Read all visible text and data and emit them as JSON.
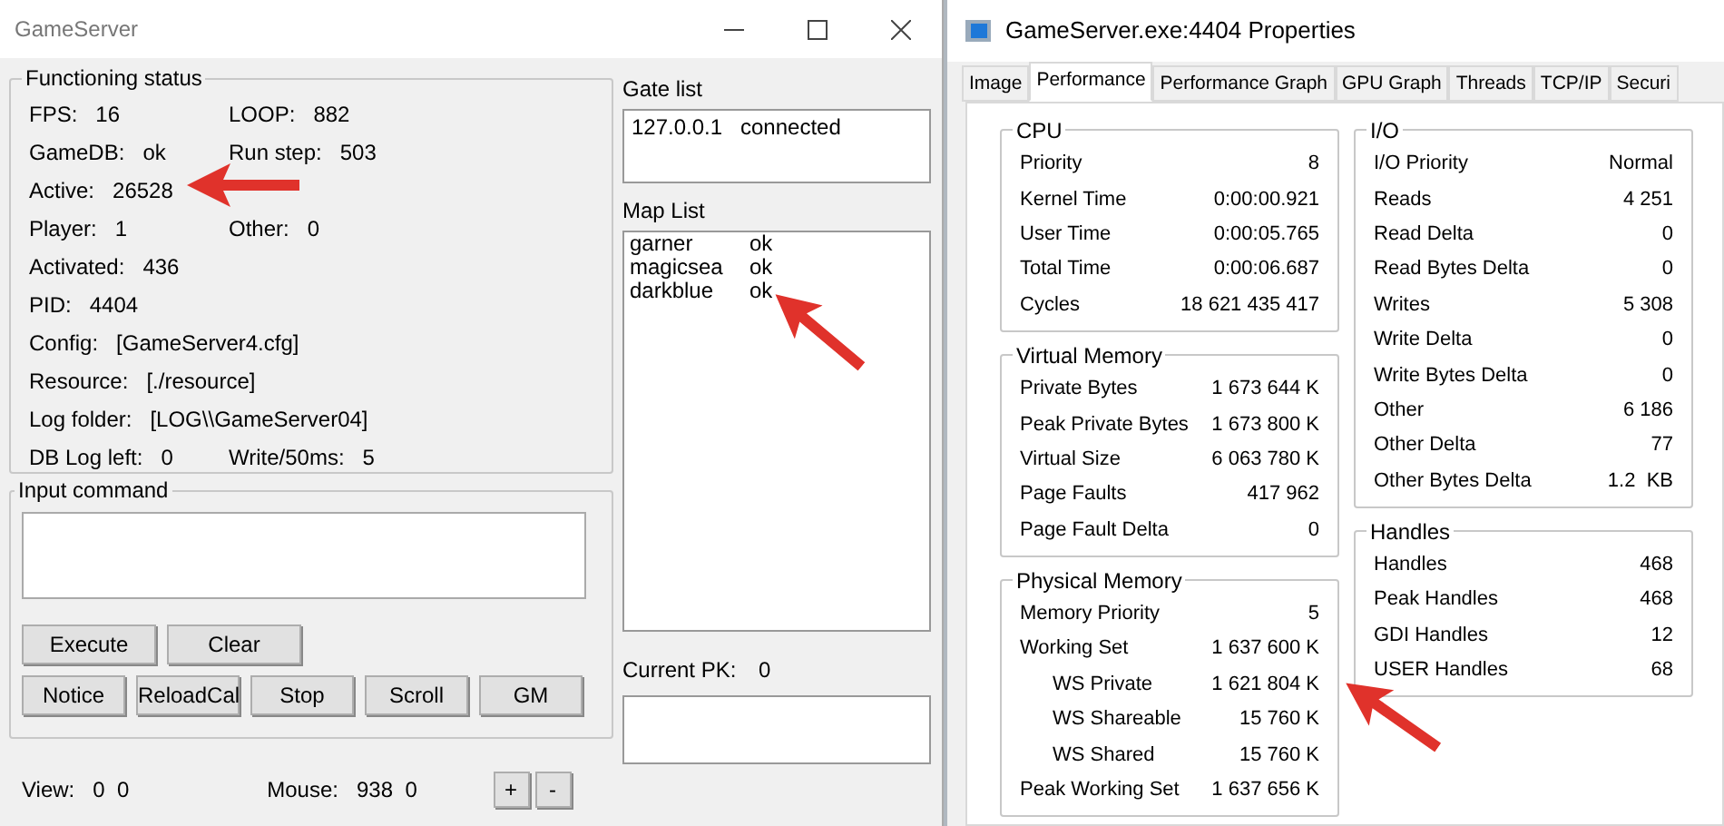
{
  "game_server": {
    "title": "GameServer",
    "status_group": {
      "title": "Functioning status",
      "rows": [
        [
          {
            "label": "FPS:",
            "value": "16"
          },
          {
            "label": "LOOP:",
            "value": "882"
          }
        ],
        [
          {
            "label": "GameDB:",
            "value": "ok"
          },
          {
            "label": "Run step:",
            "value": "503"
          }
        ],
        [
          {
            "label": "Active:",
            "value": "26528"
          }
        ],
        [
          {
            "label": "Player:",
            "value": "1"
          },
          {
            "label": "Other:",
            "value": "0"
          }
        ],
        [
          {
            "label": "Activated:",
            "value": "436"
          }
        ],
        [
          {
            "label": "PID:",
            "value": "4404"
          }
        ],
        [
          {
            "label": "Config:",
            "value": "[GameServer4.cfg]"
          }
        ],
        [
          {
            "label": "Resource:",
            "value": "[./resource]"
          }
        ],
        [
          {
            "label": "Log folder:",
            "value": "[LOG\\\\GameServer04]"
          }
        ],
        [
          {
            "label": "DB Log left:",
            "value": "0"
          },
          {
            "label": "Write/50ms:",
            "value": "5"
          }
        ]
      ]
    },
    "input_group": {
      "title": "Input command",
      "button_rows": [
        [
          "Execute",
          "Clear"
        ],
        [
          "Notice",
          "ReloadCal",
          "Stop",
          "Scroll",
          "GM"
        ]
      ]
    },
    "gate_list": {
      "title": "Gate list",
      "rows": [
        {
          "name": "127.0.0.1",
          "status": "connected"
        }
      ]
    },
    "map_list": {
      "title": "Map List",
      "rows": [
        {
          "name": "garner",
          "status": "ok"
        },
        {
          "name": "magicsea",
          "status": "ok"
        },
        {
          "name": "darkblue",
          "status": "ok"
        }
      ]
    },
    "current_pk": {
      "label": "Current PK:",
      "value": "0"
    },
    "view": {
      "label": "View:",
      "value": "0  0"
    },
    "mouse": {
      "label": "Mouse:",
      "value": "938  0"
    },
    "zoom_buttons": [
      "+",
      "-"
    ]
  },
  "properties": {
    "title": "GameServer.exe:4404 Properties",
    "tabs": [
      {
        "label": "Image",
        "selected": false
      },
      {
        "label": "Performance",
        "selected": true
      },
      {
        "label": "Performance Graph",
        "selected": false
      },
      {
        "label": "GPU Graph",
        "selected": false
      },
      {
        "label": "Threads",
        "selected": false
      },
      {
        "label": "TCP/IP",
        "selected": false
      },
      {
        "label": "Securi",
        "selected": false
      }
    ],
    "left_column": [
      {
        "title": "CPU",
        "rows": [
          {
            "label": "Priority",
            "value": "8"
          },
          {
            "label": "Kernel Time",
            "value": "0:00:00.921"
          },
          {
            "label": "User Time",
            "value": "0:00:05.765"
          },
          {
            "label": "Total Time",
            "value": "0:00:06.687"
          },
          {
            "label": "Cycles",
            "value": "18 621 435 417"
          }
        ]
      },
      {
        "title": "Virtual Memory",
        "rows": [
          {
            "label": "Private Bytes",
            "value": "1 673 644 K"
          },
          {
            "label": "Peak Private Bytes",
            "value": "1 673 800 K"
          },
          {
            "label": "Virtual Size",
            "value": "6 063 780 K"
          },
          {
            "label": "Page Faults",
            "value": "417 962"
          },
          {
            "label": "Page Fault Delta",
            "value": "0"
          }
        ]
      },
      {
        "title": "Physical Memory",
        "rows": [
          {
            "label": "Memory Priority",
            "value": "5"
          },
          {
            "label": "Working Set",
            "value": "1 637 600 K",
            "children": [
              {
                "label": "WS Private",
                "value": "1 621 804 K"
              },
              {
                "label": "WS Shareable",
                "value": "15 760 K"
              },
              {
                "label": "WS Shared",
                "value": "15 760 K"
              }
            ]
          },
          {
            "label": "Peak Working Set",
            "value": "1 637 656 K"
          }
        ]
      }
    ],
    "right_column": [
      {
        "title": "I/O",
        "rows": [
          {
            "label": "I/O Priority",
            "value": "Normal"
          },
          {
            "label": "Reads",
            "value": "4 251"
          },
          {
            "label": "Read Delta",
            "value": "0"
          },
          {
            "label": "Read Bytes Delta",
            "value": "0"
          },
          {
            "label": "Writes",
            "value": "5 308"
          },
          {
            "label": "Write Delta",
            "value": "0"
          },
          {
            "label": "Write Bytes Delta",
            "value": "0"
          },
          {
            "label": "Other",
            "value": "6 186"
          },
          {
            "label": "Other Delta",
            "value": "77"
          },
          {
            "label": "Other Bytes Delta",
            "value": "1.2  KB"
          }
        ]
      },
      {
        "title": "Handles",
        "rows": [
          {
            "label": "Handles",
            "value": "468"
          },
          {
            "label": "Peak Handles",
            "value": "468"
          },
          {
            "label": "GDI Handles",
            "value": "12"
          },
          {
            "label": "USER Handles",
            "value": "68"
          }
        ]
      }
    ]
  }
}
